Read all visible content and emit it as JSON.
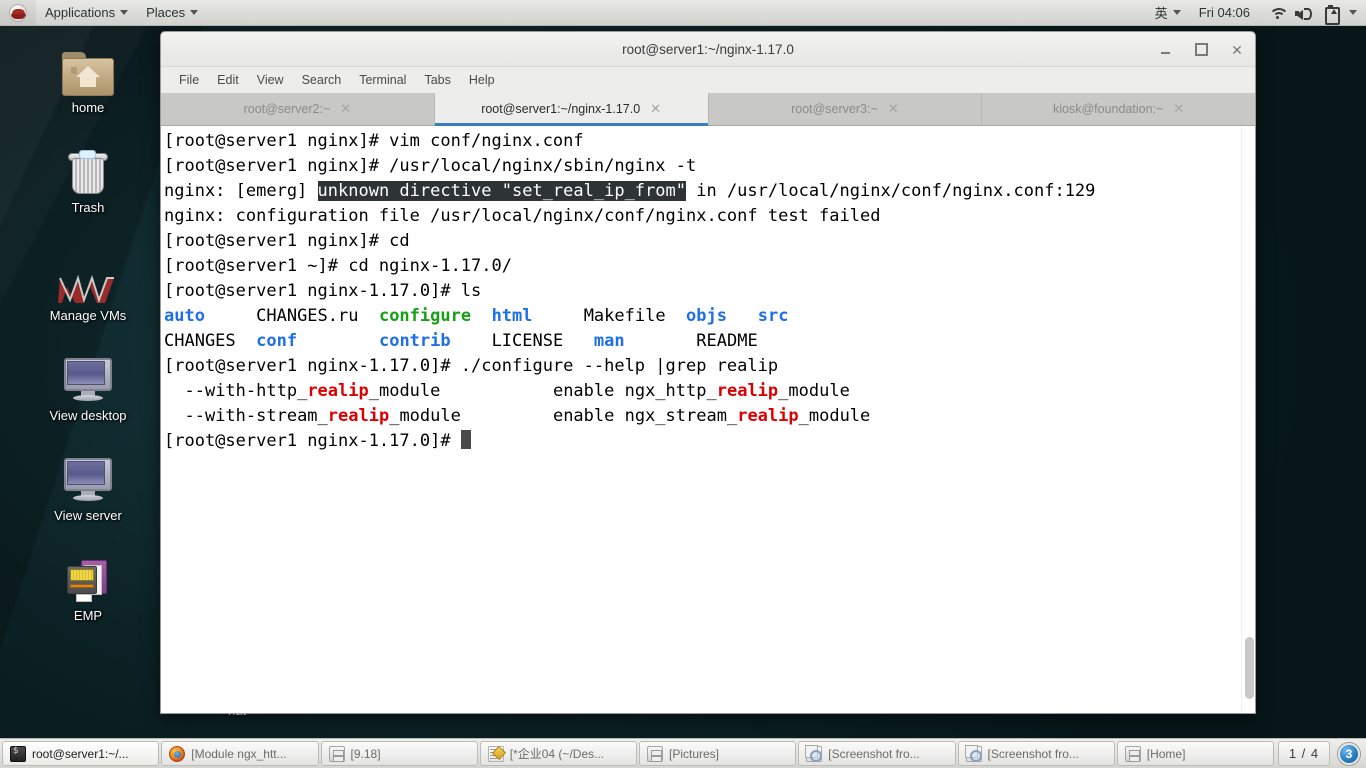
{
  "top_panel": {
    "logo": "redhat-logo",
    "applications_label": "Applications",
    "places_label": "Places",
    "input_method": "英",
    "clock": "Fri 04:06",
    "icons": [
      "wifi-icon",
      "volume-icon",
      "battery-icon",
      "chevron-down-icon"
    ]
  },
  "desktop": {
    "icons": [
      {
        "label": "home",
        "icon": "home-folder-icon"
      },
      {
        "label": "Trash",
        "icon": "trash-icon"
      },
      {
        "label": "Manage VMs",
        "icon": "vm-logo-icon"
      },
      {
        "label": "View desktop",
        "icon": "monitor-icon"
      },
      {
        "label": "View server",
        "icon": "monitor-icon"
      },
      {
        "label": "EMP",
        "icon": "emp-device-icon"
      }
    ],
    "occluded_label": "hat"
  },
  "terminal": {
    "title": "root@server1:~/nginx-1.17.0",
    "window_buttons": {
      "minimize": "_",
      "maximize": "□",
      "close": "✕"
    },
    "menu": [
      "File",
      "Edit",
      "View",
      "Search",
      "Terminal",
      "Tabs",
      "Help"
    ],
    "tabs": [
      {
        "title": "root@server2:~",
        "close": "✕",
        "active": false
      },
      {
        "title": "root@server1:~/nginx-1.17.0",
        "close": "✕",
        "active": true
      },
      {
        "title": "root@server3:~",
        "close": "✕",
        "active": false
      },
      {
        "title": "kiosk@foundation:~",
        "close": "✕",
        "active": false
      }
    ],
    "lines": [
      {
        "segments": [
          {
            "t": "[root@server1 nginx]# vim conf/nginx.conf"
          }
        ]
      },
      {
        "segments": [
          {
            "t": "[root@server1 nginx]# /usr/local/nginx/sbin/nginx -t"
          }
        ]
      },
      {
        "segments": [
          {
            "t": "nginx: [emerg] "
          },
          {
            "t": "unknown directive \"set_real_ip_from\"",
            "c": "sel"
          },
          {
            "t": " in /usr/local/nginx/conf/nginx.conf:129"
          }
        ]
      },
      {
        "segments": [
          {
            "t": "nginx: configuration file /usr/local/nginx/conf/nginx.conf test failed"
          }
        ]
      },
      {
        "segments": [
          {
            "t": "[root@server1 nginx]# cd"
          }
        ]
      },
      {
        "segments": [
          {
            "t": "[root@server1 ~]# cd nginx-1.17.0/"
          }
        ]
      },
      {
        "segments": [
          {
            "t": "[root@server1 nginx-1.17.0]# ls"
          }
        ]
      },
      {
        "segments": [
          {
            "t": "auto",
            "c": "dir"
          },
          {
            "t": "     CHANGES.ru  "
          },
          {
            "t": "configure",
            "c": "exec"
          },
          {
            "t": "  "
          },
          {
            "t": "html",
            "c": "dir"
          },
          {
            "t": "     Makefile  "
          },
          {
            "t": "objs",
            "c": "dir"
          },
          {
            "t": "   "
          },
          {
            "t": "src",
            "c": "dir"
          }
        ]
      },
      {
        "segments": [
          {
            "t": "CHANGES  "
          },
          {
            "t": "conf",
            "c": "dir"
          },
          {
            "t": "        "
          },
          {
            "t": "contrib",
            "c": "dir"
          },
          {
            "t": "    LICENSE   "
          },
          {
            "t": "man",
            "c": "dir"
          },
          {
            "t": "       README"
          }
        ]
      },
      {
        "segments": [
          {
            "t": "[root@server1 nginx-1.17.0]# ./configure --help |grep realip"
          }
        ]
      },
      {
        "segments": [
          {
            "t": "  --with-http_"
          },
          {
            "t": "realip",
            "c": "match"
          },
          {
            "t": "_module           enable ngx_http_"
          },
          {
            "t": "realip",
            "c": "match"
          },
          {
            "t": "_module"
          }
        ]
      },
      {
        "segments": [
          {
            "t": "  --with-stream_"
          },
          {
            "t": "realip",
            "c": "match"
          },
          {
            "t": "_module         enable ngx_stream_"
          },
          {
            "t": "realip",
            "c": "match"
          },
          {
            "t": "_module"
          }
        ]
      },
      {
        "segments": [
          {
            "t": "[root@server1 nginx-1.17.0]# "
          },
          {
            "cursor": true
          }
        ]
      }
    ],
    "colors": {
      "directory": "#1f6fe8",
      "executable": "#17a017",
      "grep_match": "#dd0000",
      "selection_bg": "#2e3436",
      "background": "#ffffff",
      "foreground": "#000000",
      "active_tab_accent": "#3a7fc1"
    }
  },
  "taskbar": {
    "items": [
      {
        "label": "root@server1:~/...",
        "icon": "terminal-icon",
        "active": true
      },
      {
        "label": "[Module ngx_htt...",
        "icon": "firefox-icon",
        "active": false
      },
      {
        "label": "[9.18]",
        "icon": "file-manager-icon",
        "active": false
      },
      {
        "label": "[*企业04 (~/Des...",
        "icon": "text-editor-icon",
        "active": false
      },
      {
        "label": "[Pictures]",
        "icon": "file-manager-icon",
        "active": false
      },
      {
        "label": "[Screenshot fro...",
        "icon": "screenshot-icon",
        "active": false
      },
      {
        "label": "[Screenshot fro...",
        "icon": "screenshot-icon",
        "active": false
      },
      {
        "label": "[Home]",
        "icon": "file-manager-icon",
        "active": false
      }
    ],
    "workspace": "1 / 4",
    "notification_count": "3"
  }
}
